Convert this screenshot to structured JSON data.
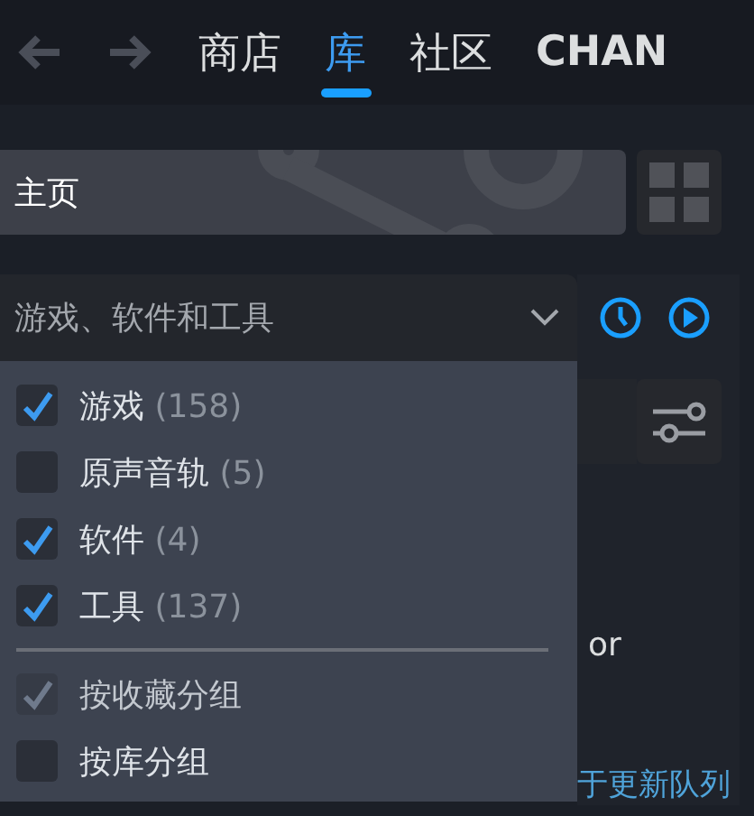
{
  "nav": {
    "tabs": [
      {
        "label": "商店",
        "selected": false
      },
      {
        "label": "库",
        "selected": true
      },
      {
        "label": "社区",
        "selected": false
      },
      {
        "label": "CHAN",
        "selected": false
      }
    ]
  },
  "home": {
    "label": "主页"
  },
  "collection_dropdown": {
    "value": "游戏、软件和工具",
    "expanded": true,
    "options": [
      {
        "label": "游戏",
        "count": "(158)",
        "checked": true,
        "disabled": false
      },
      {
        "label": "原声音轨",
        "count": "(5)",
        "checked": false,
        "disabled": false
      },
      {
        "label": "软件",
        "count": "(4)",
        "checked": true,
        "disabled": false
      },
      {
        "label": "工具",
        "count": "(137)",
        "checked": true,
        "disabled": false
      }
    ],
    "group_options": [
      {
        "label": "按收藏分组",
        "checked": true,
        "disabled": true
      },
      {
        "label": "按库分组",
        "checked": false,
        "disabled": false
      }
    ]
  },
  "background_texts": [
    "or",
    "于更新队列"
  ]
}
